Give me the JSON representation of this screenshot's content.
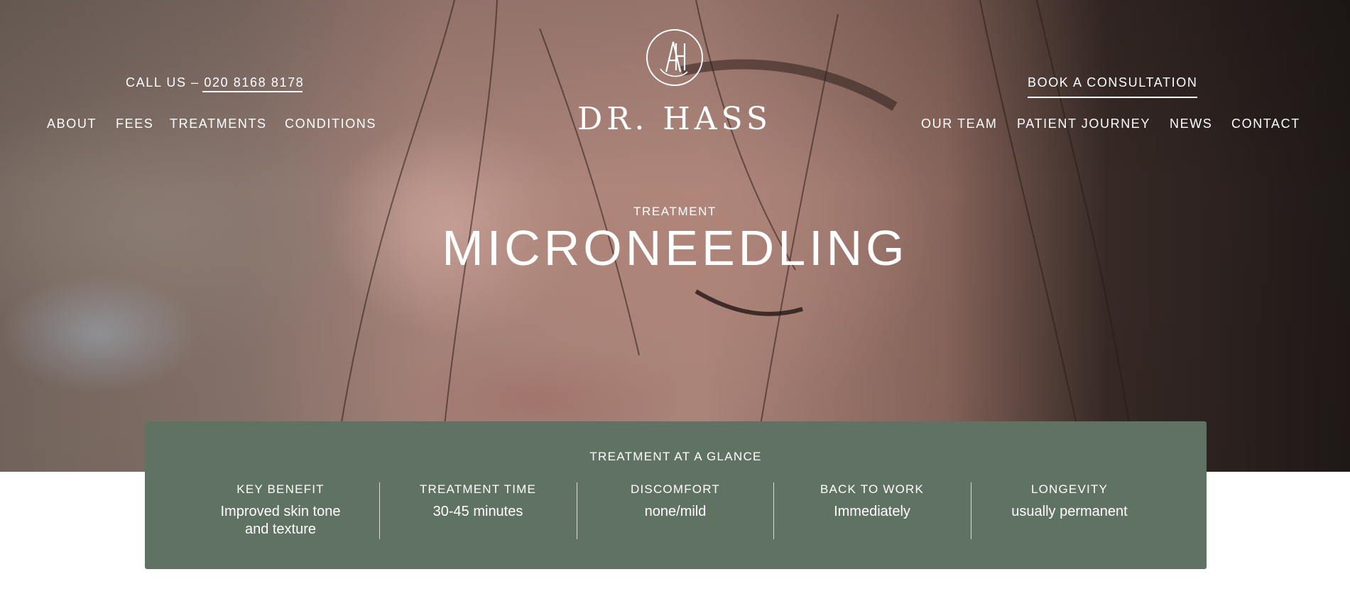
{
  "header": {
    "phone_cta": "CALL US – 020 8168 8178",
    "consult_cta": "BOOK A CONSULTATION",
    "nav_left": [
      "ABOUT",
      "FEES",
      "TREATMENTS",
      "CONDITIONS"
    ],
    "nav_right": [
      "OUR TEAM",
      "PATIENT JOURNEY",
      "NEWS",
      "CONTACT"
    ],
    "logo": {
      "monogram": "AH",
      "wordmark": "DR. HASS"
    }
  },
  "hero": {
    "eyebrow": "TREATMENT",
    "title": "MICRONEEDLING"
  },
  "glance": {
    "title": "TREATMENT AT A GLANCE",
    "items": [
      {
        "label": "KEY BENEFIT",
        "value": "Improved skin tone and texture"
      },
      {
        "label": "TREATMENT TIME",
        "value": "30-45 minutes"
      },
      {
        "label": "DISCOMFORT",
        "value": "none/mild"
      },
      {
        "label": "BACK TO WORK",
        "value": "Immediately"
      },
      {
        "label": "LONGEVITY",
        "value": "usually permanent"
      }
    ]
  },
  "colors": {
    "glance_panel": "#607262",
    "text_on_dark": "#ffffff",
    "page_background": "#ffffff"
  }
}
